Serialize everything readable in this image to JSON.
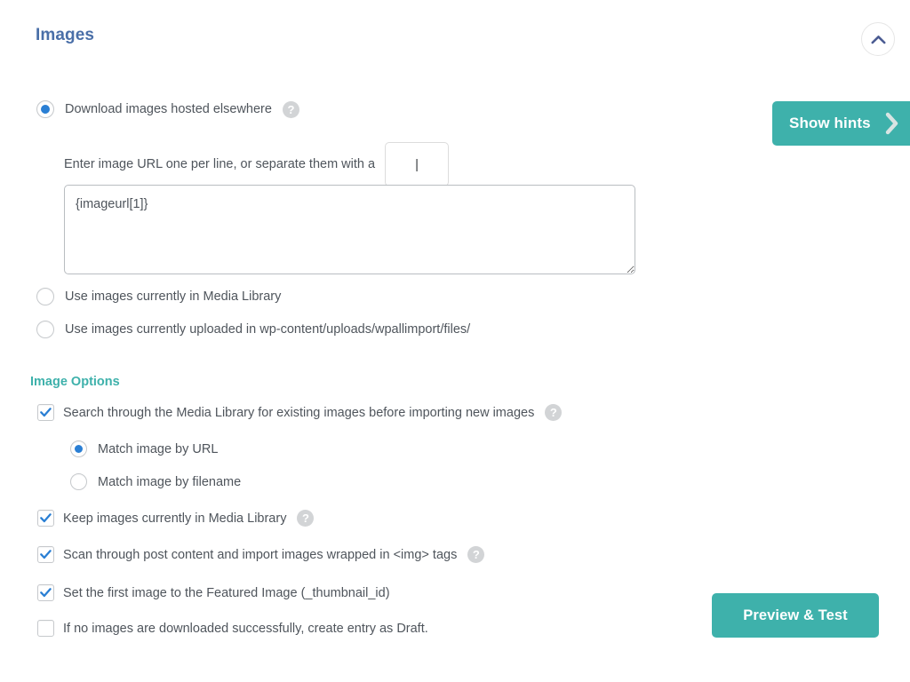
{
  "panel": {
    "title": "Images",
    "collapse_icon": "chevron-up-icon"
  },
  "hints_button": {
    "label": "Show hints",
    "icon": "chevron-right-icon",
    "color": "#3eb1ab"
  },
  "source": {
    "options": [
      {
        "label": "Download images hosted elsewhere",
        "checked": true,
        "has_help": true
      },
      {
        "label": "Use images currently in Media Library",
        "checked": false,
        "has_help": false
      },
      {
        "label": "Use images currently uploaded in wp-content/uploads/wpallimport/files/",
        "checked": false,
        "has_help": false
      }
    ],
    "separator_label": "Enter image URL one per line, or separate them with a",
    "separator_value": "|",
    "urls_value": "{imageurl[1]}"
  },
  "image_options": {
    "heading": "Image Options",
    "search_media_library": {
      "label": "Search through the Media Library for existing images before importing new images",
      "checked": true,
      "has_help": true
    },
    "match_options": [
      {
        "label": "Match image by URL",
        "checked": true
      },
      {
        "label": "Match image by filename",
        "checked": false
      }
    ],
    "checkboxes": [
      {
        "label": "Keep images currently in Media Library",
        "checked": true,
        "has_help": true
      },
      {
        "label": "Scan through post content and import images wrapped in <img> tags",
        "checked": true,
        "has_help": true
      },
      {
        "label": "Set the first image to the Featured Image (_thumbnail_id)",
        "checked": true,
        "has_help": false
      },
      {
        "label": "If no images are downloaded successfully, create entry as Draft.",
        "checked": false,
        "has_help": false
      }
    ]
  },
  "preview_button": {
    "label": "Preview & Test",
    "color": "#3eb1ab"
  },
  "help_icon": {
    "glyph": "?",
    "name": "help-icon"
  },
  "colors": {
    "accent_teal": "#3eb1ab",
    "title_blue": "#4a6fa8",
    "control_blue": "#2a7fd4",
    "text": "#4f555c"
  }
}
